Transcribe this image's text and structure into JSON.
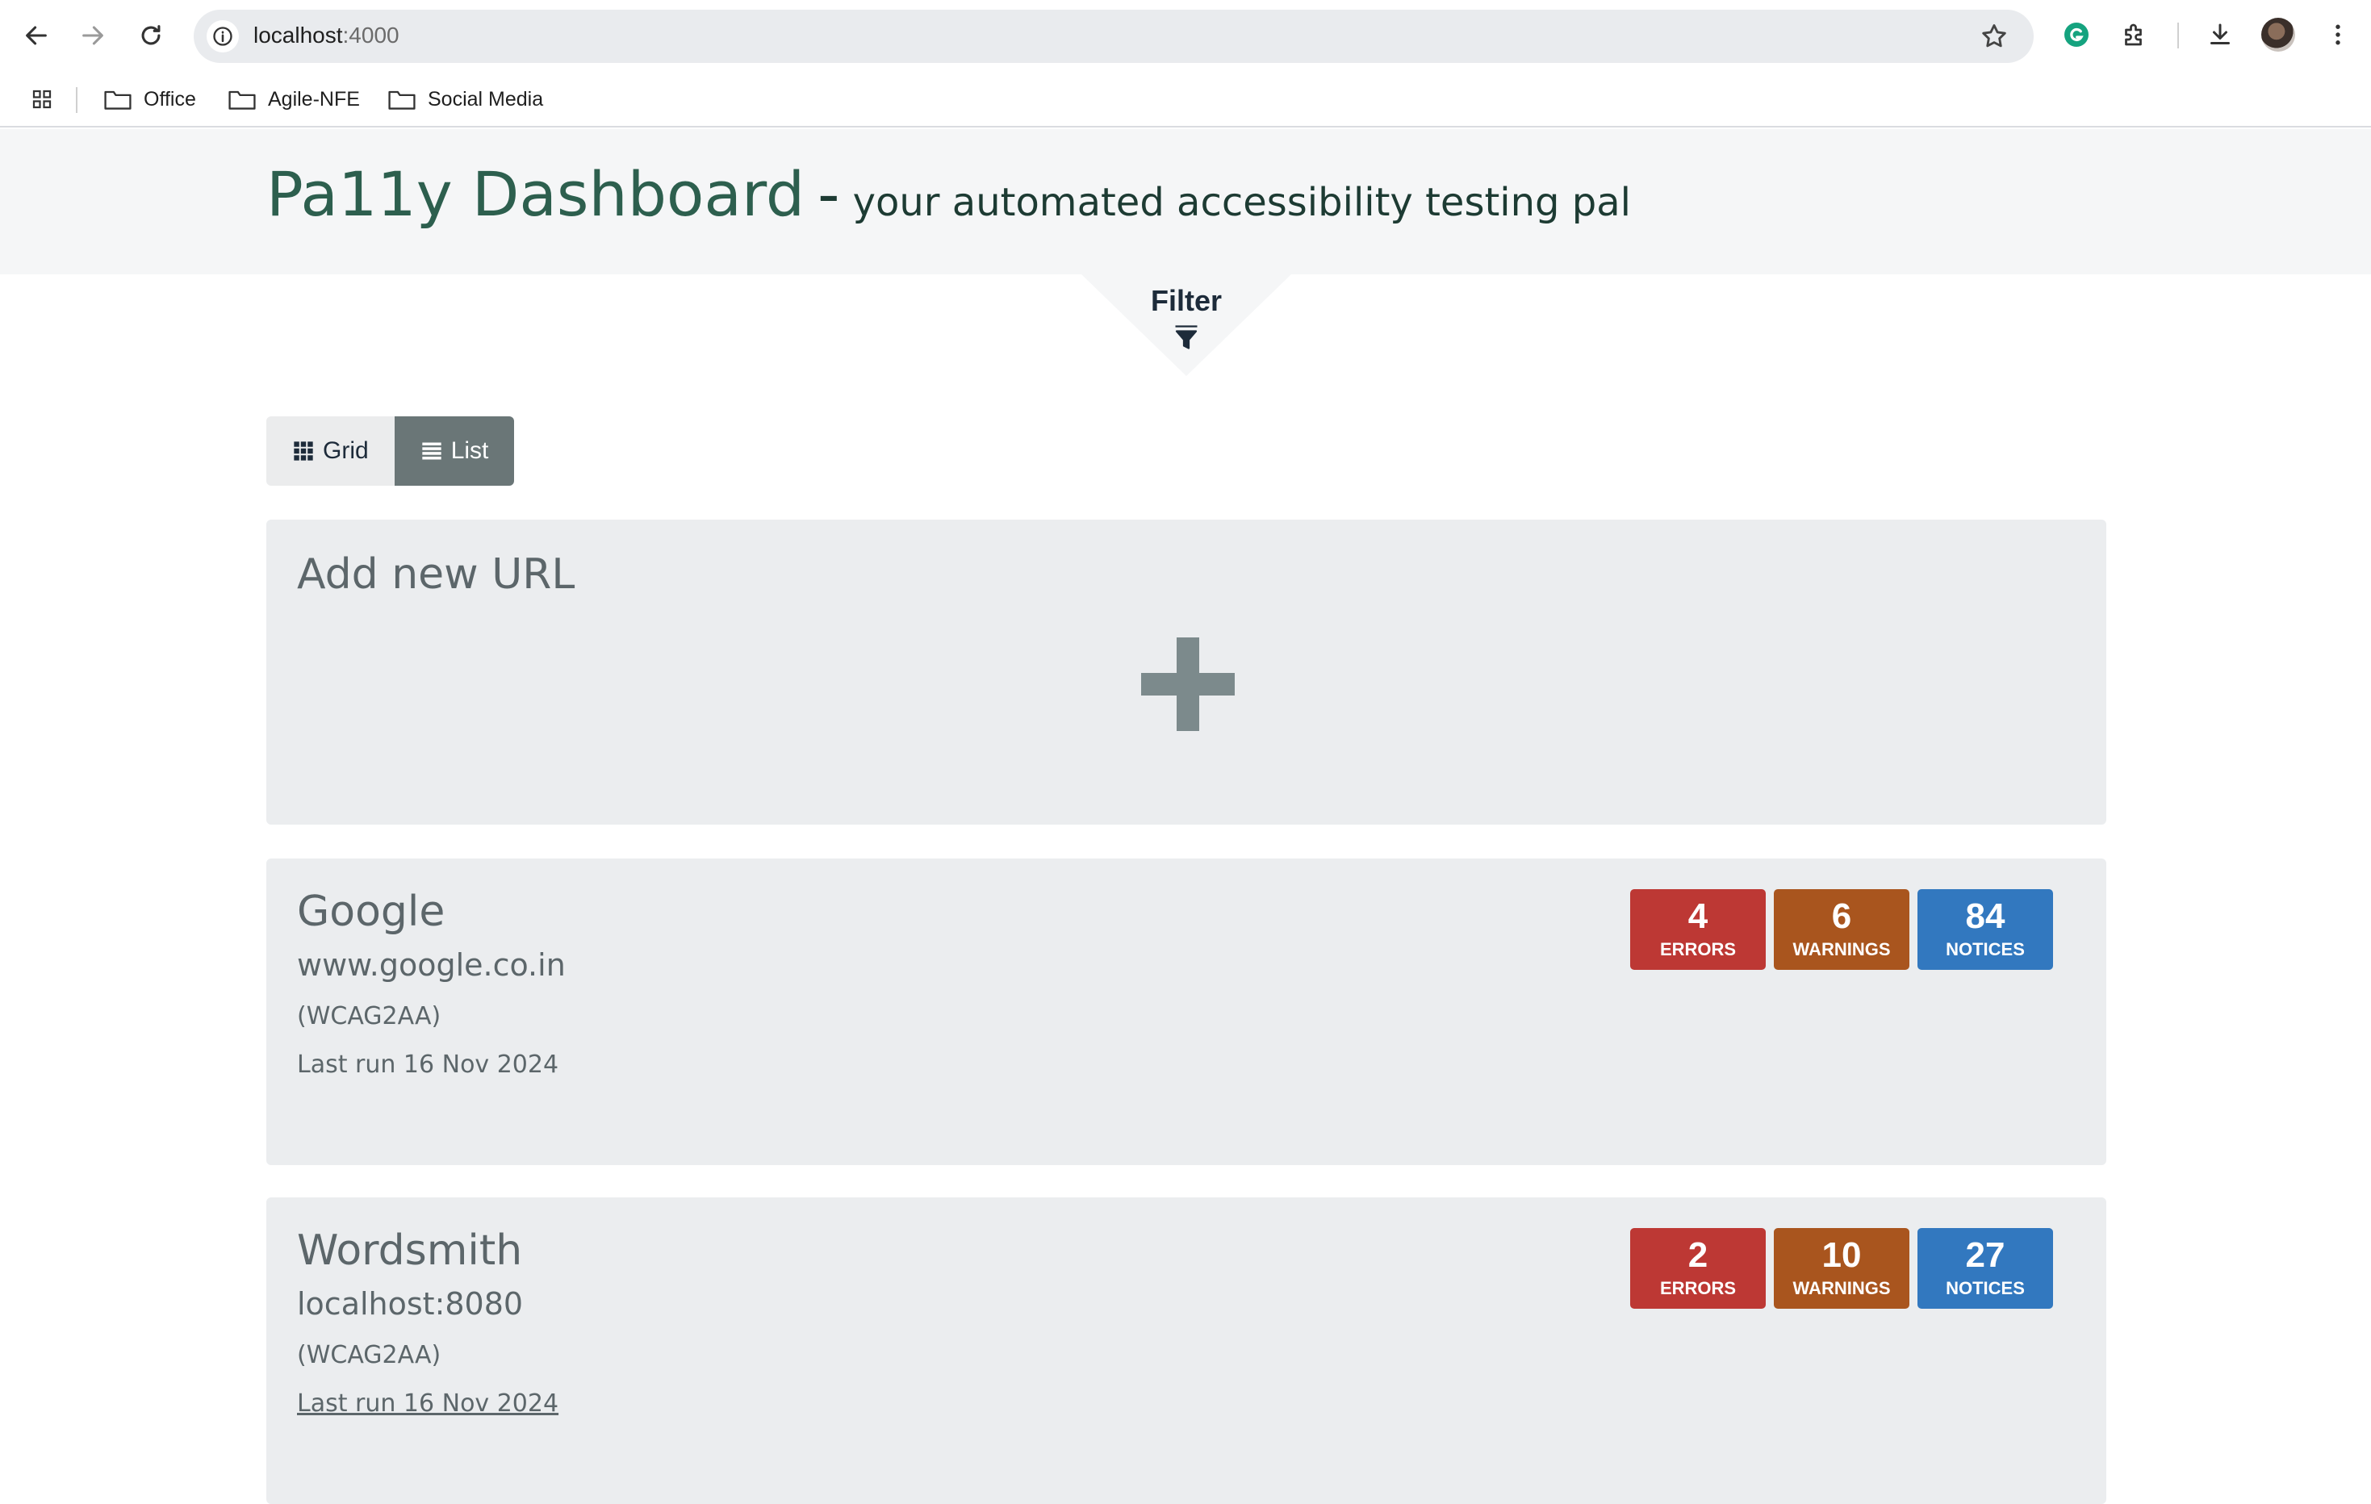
{
  "browser": {
    "url_host": "localhost",
    "url_port": ":4000",
    "bookmarks": [
      {
        "label": "Office"
      },
      {
        "label": "Agile-NFE"
      },
      {
        "label": "Social Media"
      }
    ]
  },
  "header": {
    "brand": "Pa11y Dashboard",
    "separator": "-",
    "tagline": "your automated accessibility testing pal"
  },
  "filter": {
    "label": "Filter"
  },
  "view_toggle": {
    "grid_label": "Grid",
    "list_label": "List",
    "active": "List"
  },
  "add_card": {
    "heading": "Add new URL"
  },
  "sites": [
    {
      "name": "Google",
      "url": "www.google.co.in",
      "standard": "(WCAG2AA)",
      "last_run": "Last run 16 Nov 2024",
      "errors": "4",
      "warnings": "6",
      "notices": "84",
      "errors_label": "ERRORS",
      "warnings_label": "WARNINGS",
      "notices_label": "NOTICES"
    },
    {
      "name": "Wordsmith",
      "url": "localhost:8080",
      "standard": "(WCAG2AA)",
      "last_run": "Last run 16 Nov 2024",
      "errors": "2",
      "warnings": "10",
      "notices": "27",
      "errors_label": "ERRORS",
      "warnings_label": "WARNINGS",
      "notices_label": "NOTICES"
    }
  ],
  "colors": {
    "brand_green": "#2d5f4e",
    "errors": "#bd3834",
    "warnings": "#a9551e",
    "notices": "#3278bf",
    "list_active": "#6a7677"
  }
}
